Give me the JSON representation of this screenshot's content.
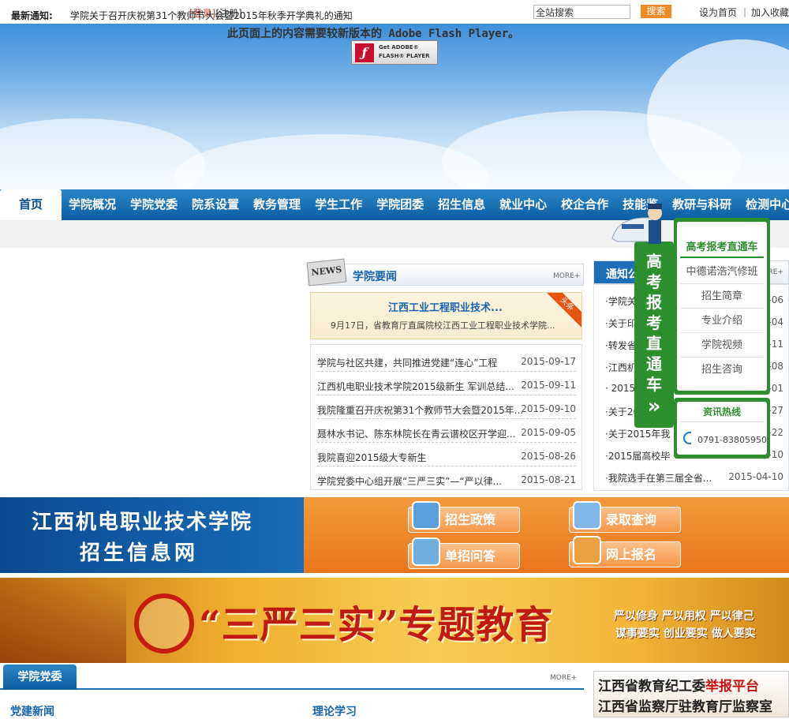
{
  "topbar": {
    "login": "[登录]",
    "register": "[注册]",
    "search_placeholder": "全站搜索",
    "search_button": "搜索",
    "set_homepage": "设为首页",
    "add_favorite": "加入收藏",
    "separator": "|"
  },
  "banner": {
    "flash_message": "此页面上的内容需要较新版本的 Adobe Flash Player。",
    "flash_button_line1": "Get ADOBE®",
    "flash_button_line2": "FLASH® PLAYER"
  },
  "nav": {
    "items": [
      "首页",
      "学院概况",
      "学院党委",
      "院系设置",
      "教务管理",
      "学生工作",
      "学院团委",
      "招生信息",
      "就业中心",
      "校企合作",
      "技能鉴",
      "教研与科研",
      "检测中心"
    ]
  },
  "notice_bar": {
    "label": "最新通知:",
    "text": "学院关于召开庆祝第31个教师节大会暨2015年秋季开学典礼的通知"
  },
  "news": {
    "title": "学院要闻",
    "more": "MORE+",
    "icon_text": "NEWS",
    "headline": {
      "title": "江西工业工程职业技术...",
      "summary": "9月17日，省教育厅直属院校江西工业工程职业技术学院...",
      "tag": "头条"
    },
    "items": [
      {
        "title": "学院与社区共建，共同推进党建“连心”工程",
        "date": "2015-09-17"
      },
      {
        "title": "江西机电职业技术学院2015级新生 军训总结...",
        "date": "2015-09-11"
      },
      {
        "title": "我院隆重召开庆祝第31个教师节大会暨2015年...",
        "date": "2015-09-10"
      },
      {
        "title": "聂林水书记、陈东林院长在青云谱校区开学迎...",
        "date": "2015-09-05"
      },
      {
        "title": "我院喜迎2015级大专新生",
        "date": "2015-08-26"
      },
      {
        "title": "学院党委中心组开展“三严三实”—“严以律...",
        "date": "2015-08-21"
      }
    ]
  },
  "notices": {
    "title": "通知公",
    "more": "ORE+",
    "items": [
      {
        "title": "·学院关",
        "date": "-06"
      },
      {
        "title": "·关于印",
        "date": "-04"
      },
      {
        "title": "·转发省",
        "date": "-11"
      },
      {
        "title": "·江西机",
        "date": "-08"
      },
      {
        "title": "· 2015",
        "date": "-01"
      },
      {
        "title": "·关于2015年署",
        "date": "-27"
      },
      {
        "title": "·关于2015年我",
        "date": "-22"
      },
      {
        "title": "·2015届高校毕",
        "date": "-10"
      },
      {
        "title": "·我院选手在第三届全省...",
        "date": "2015-04-10"
      }
    ]
  },
  "sidebar": {
    "vertical_title": "高考报考直通车",
    "arrow": "»",
    "title": "高考报考直通车",
    "items": [
      "中德诺浩汽修班",
      "招生简章",
      "专业介绍",
      "学院视频",
      "招生咨询"
    ],
    "hotline_label": "资讯热线",
    "phone": "0791-83805950"
  },
  "enroll": {
    "school_name": "江西机电职业技术学院",
    "subtitle": "招生信息网",
    "buttons": [
      "招生政策",
      "录取查询",
      "单招问答",
      "网上报名"
    ]
  },
  "party_banner": {
    "title": "“三严三实”专题教育",
    "line1": "严以修身  严以用权  严以律己",
    "line2": "谋事要实  创业要实  做人要实"
  },
  "party_section": {
    "tab": "学院党委",
    "more": "MORE+",
    "col1": "党建新闻",
    "col2": "理论学习"
  },
  "report_platform": {
    "line1_prefix": "江西省教育纪工委",
    "line1_highlight": "举报平台",
    "line2": "江西省监察厅驻教育厅监察室"
  },
  "colors": {
    "nav_blue": "#0e5ca0",
    "accent_orange": "#f08a24",
    "sidebar_green": "#2c8e2c",
    "link_blue": "#1a64b0"
  }
}
